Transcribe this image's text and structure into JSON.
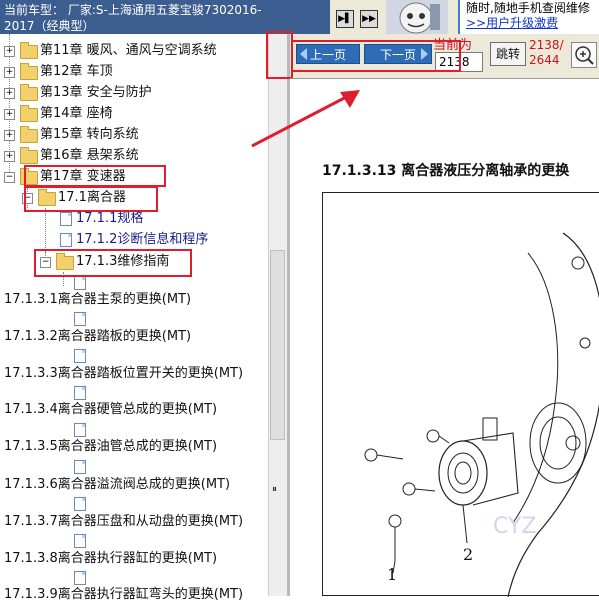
{
  "header": {
    "car_label": "当前车型：",
    "car_value": "厂家:S-上海通用五菱宝骏7302016-",
    "car_value_line2": "2017（经典型）",
    "promo_line1": "随时,随地手机查阅维修",
    "promo_line2": ">>用户升级激费"
  },
  "tree": {
    "items": [
      {
        "label": "第11章 暖风、通风与空调系统"
      },
      {
        "label": "第12章 车顶"
      },
      {
        "label": "第13章 安全与防护"
      },
      {
        "label": "第14章 座椅"
      },
      {
        "label": "第15章 转向系统"
      },
      {
        "label": "第16章 悬架系统"
      },
      {
        "label": "第17章 变速器"
      },
      {
        "label": "17.1离合器"
      },
      {
        "label": "17.1.1规格"
      },
      {
        "label": "17.1.2诊断信息和程序"
      },
      {
        "label": "17.1.3维修指南"
      }
    ],
    "topics": [
      {
        "label": "17.1.3.1离合器主泵的更换(MT)"
      },
      {
        "label": "17.1.3.2离合器踏板的更换(MT)"
      },
      {
        "label": "17.1.3.3离合器踏板位置开关的更换(MT)"
      },
      {
        "label": "17.1.3.4离合器硬管总成的更换(MT)"
      },
      {
        "label": "17.1.3.5离合器油管总成的更换(MT)"
      },
      {
        "label": "17.1.3.6离合器溢流阀总成的更换(MT)"
      },
      {
        "label": "17.1.3.7离合器压盘和从动盘的更换(MT)"
      },
      {
        "label": "17.1.3.8离合器执行器缸的更换(MT)"
      },
      {
        "label": "17.1.3.9离合器执行器缸弯头的更换(MT)"
      }
    ]
  },
  "nav": {
    "prev_label": "上一页",
    "next_label": "下一页",
    "current_label": "当前为",
    "page_value": "2138",
    "jump_label": "跳转",
    "page_count_line1": "2138/",
    "page_count_line2": "2644"
  },
  "doc": {
    "title": "17.1.3.13  离合器液压分离轴承的更换",
    "callout_1": "1",
    "callout_2": "2",
    "watermark": "CYZ"
  },
  "colors": {
    "highlight_box": "#e01d2c",
    "nav_button": "#2e6db6",
    "page_count": "#d0101c"
  }
}
